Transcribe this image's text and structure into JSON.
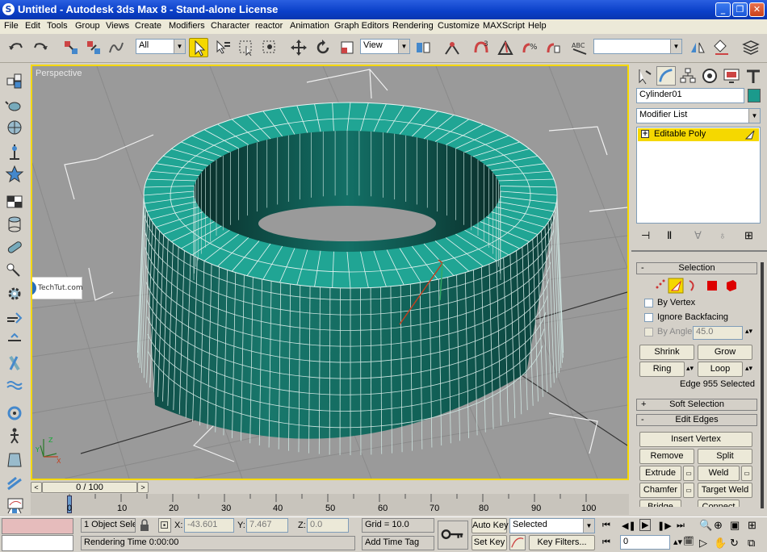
{
  "window": {
    "title": "Untitled - Autodesk 3ds Max 8  - Stand-alone License",
    "app_glyph": "S",
    "btn_min": "_",
    "btn_max": "❐",
    "btn_close": "✕"
  },
  "menu": [
    "File",
    "Edit",
    "Tools",
    "Group",
    "Views",
    "Create",
    "Modifiers",
    "Character",
    "reactor",
    "Animation",
    "Graph Editors",
    "Rendering",
    "Customize",
    "MAXScript",
    "Help"
  ],
  "toolbar": {
    "selection_filter": "All",
    "coord_system": "View",
    "named_selection": ""
  },
  "viewport": {
    "label": "Perspective",
    "watermark": "TechTut.com",
    "accent": "#f5d800",
    "object_color": "#1b9a8c"
  },
  "timeline": {
    "frame_readout": "0 / 100",
    "ticks": [
      "0",
      "10",
      "20",
      "30",
      "40",
      "50",
      "60",
      "70",
      "80",
      "90",
      "100"
    ]
  },
  "status": {
    "selection_count": "1 Object Sele",
    "x_label": "X:",
    "x_value": "-43.601",
    "y_label": "Y:",
    "y_value": "7.467",
    "z_label": "Z:",
    "z_value": "0.0",
    "grid": "Grid = 10.0",
    "rendering_time": "Rendering Time  0:00:00",
    "add_time_tag": "Add Time Tag",
    "auto_key": "Auto Key",
    "set_key": "Set Key",
    "key_mode": "Selected",
    "key_filters": "Key Filters...",
    "current_frame": "0"
  },
  "command_panel": {
    "object_name": "Cylinder01",
    "object_color": "#1b9a8c",
    "modifier_list": "Modifier List",
    "stack_item": "Editable Poly",
    "stack_expand": "+",
    "selection": {
      "header": "Selection",
      "by_vertex": "By Vertex",
      "ignore_backfacing": "Ignore Backfacing",
      "by_angle": "By Angle:",
      "angle_value": "45.0",
      "shrink": "Shrink",
      "grow": "Grow",
      "ring": "Ring",
      "loop": "Loop",
      "info": "Edge 955 Selected"
    },
    "soft_selection": "Soft Selection",
    "edit_edges": {
      "header": "Edit Edges",
      "insert_vertex": "Insert Vertex",
      "remove": "Remove",
      "split": "Split",
      "extrude": "Extrude",
      "weld": "Weld",
      "chamfer": "Chamfer",
      "target_weld": "Target Weld",
      "bridge": "Bridge",
      "connect": "Connect"
    },
    "rollout_minus": "-",
    "rollout_plus": "+"
  },
  "axis": {
    "x": "X",
    "y": "Y",
    "z": "Z"
  }
}
